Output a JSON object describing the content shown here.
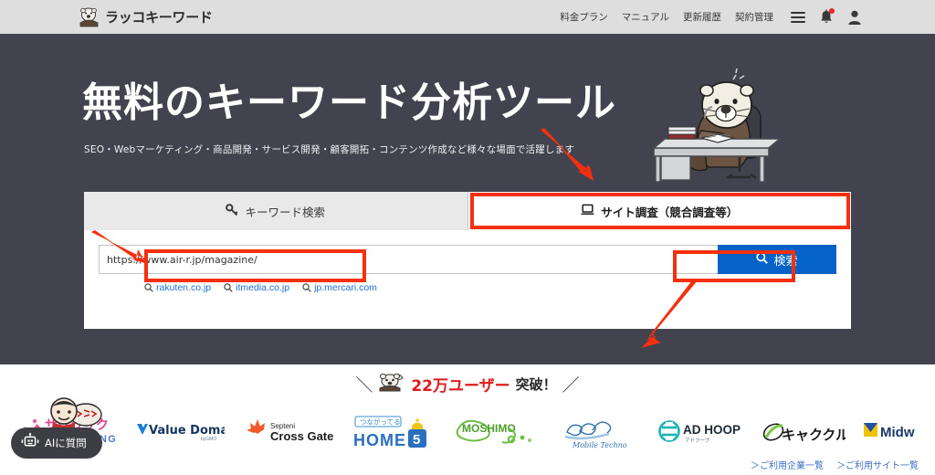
{
  "header": {
    "logo_text": "ラッコキーワード",
    "logo_icon": "otter-logo-icon",
    "nav": [
      {
        "label": "料金プラン",
        "name": "nav-pricing"
      },
      {
        "label": "マニュアル",
        "name": "nav-manual"
      },
      {
        "label": "更新履歴",
        "name": "nav-changelog"
      },
      {
        "label": "契約管理",
        "name": "nav-contract"
      }
    ],
    "icons": {
      "menu": "hamburger-menu-icon",
      "bell": "notification-bell-icon",
      "account": "user-account-icon"
    },
    "bg_color": "#dedede"
  },
  "hero": {
    "title": "無料のキーワード分析ツール",
    "subtitle": "SEO・Webマーケティング・商品開発・サービス開発・顧客開拓・コンテンツ作成など様々な場面で活躍します",
    "bg_color": "#42434e",
    "mascot": "otter-at-desk-illustration"
  },
  "search_panel": {
    "tabs": [
      {
        "label": "キーワード検索",
        "icon": "key-icon",
        "active": false,
        "name": "tab-keyword-search"
      },
      {
        "label": "サイト調査（競合調査等）",
        "icon": "laptop-icon",
        "active": true,
        "name": "tab-site-survey"
      }
    ],
    "input": {
      "value": "https://www.air-r.jp/magazine/",
      "placeholder": "https://www.air-r.jp/magazine/"
    },
    "search_button": {
      "label": "検索",
      "icon": "search-magnifier-icon",
      "color": "#0563c8"
    },
    "examples": [
      {
        "label": "rakuten.co.jp"
      },
      {
        "label": "itmedia.co.jp"
      },
      {
        "label": "jp.mercari.com"
      }
    ]
  },
  "users_banner": {
    "count": "22万ユーザー",
    "suffix": "突破！",
    "left_slash": "＼",
    "right_slash": "／",
    "icon": "otter-face-icon",
    "count_color": "#e01b1b"
  },
  "brands": [
    {
      "name": "sakurasaku-marketing",
      "line1": "サクラサク",
      "line2": "MARKETING"
    },
    {
      "name": "value-domain",
      "line1": "Value Domain",
      "line2": "byGMO"
    },
    {
      "name": "septeni-cross-gate",
      "line1": "Septeni",
      "line2": "Cross Gate"
    },
    {
      "name": "home5",
      "line1": "つながってる",
      "line2": "HOME 5"
    },
    {
      "name": "moshimo",
      "line1": "MOSHIMO",
      "line2": ""
    },
    {
      "name": "mobile-techno",
      "line1": "Mobile Techno",
      "line2": ""
    },
    {
      "name": "ad-hoop",
      "line1": "AD HOOP",
      "line2": "アドフープ"
    },
    {
      "name": "kyakukuru",
      "line1": "キャククル",
      "line2": ""
    },
    {
      "name": "midworks",
      "line1": "Midw",
      "line2": ""
    }
  ],
  "footer_links": [
    {
      "label": "＞ご利用企業一覧"
    },
    {
      "label": "＞ご利用サイト一覧"
    }
  ],
  "ai_button": {
    "label": "AIに質問",
    "icon": "robot-icon"
  },
  "annotations": {
    "color": "#f4300f",
    "boxes": [
      "site-survey-tab",
      "url-input-field",
      "search-button"
    ],
    "arrows": [
      "arrow-to-site-survey-tab",
      "arrow-to-url-input",
      "arrow-to-search-button"
    ]
  }
}
